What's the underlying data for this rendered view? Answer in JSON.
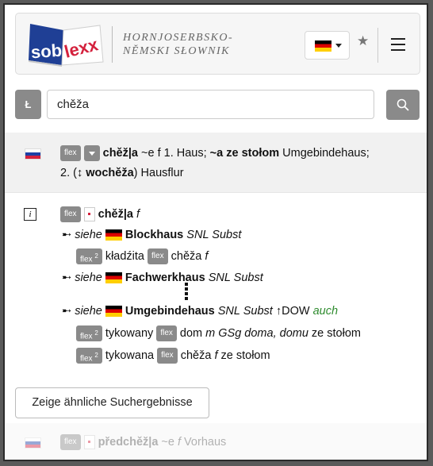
{
  "header": {
    "logo_left": "sob",
    "logo_right": "lexx",
    "title_line1": "HORNJOSERBSKO-",
    "title_line2": "NĚMSKI SŁOWNIK",
    "lang_flag": "flag-de",
    "star_icon": "star-icon",
    "menu_icon": "hamburger-icon"
  },
  "search": {
    "keyboard_label": "Ł",
    "value": "chěža",
    "button_icon": "search-icon"
  },
  "entry1": {
    "flex": "flex",
    "word": "chěž|a",
    "grammar": " ~e f 1. Haus; ",
    "phrase": "~a ze stołom",
    "phrase_tr": " Umgebindehaus;",
    "line2_prefix": "2. (↕ ",
    "line2_word": "wochěža",
    "line2_suffix": ") Hausflur"
  },
  "entry2": {
    "flex": "flex",
    "word": "chěž|a",
    "gender": "f",
    "refs": [
      {
        "siehe": "siehe",
        "word": "Blockhaus",
        "tag": "SNL Subst"
      },
      {
        "siehe": "siehe",
        "word": "Fachwerkhaus",
        "tag": "SNL Subst"
      },
      {
        "siehe": "siehe",
        "word": "Umgebindehaus",
        "tag": "SNL Subst",
        "dow": " ↑DOW ",
        "auch": "auch"
      }
    ],
    "sub1": {
      "flex2": "flex",
      "sup": "2",
      "w1": "kładźita",
      "flex": "flex",
      "w2": "chěža",
      "g": "f"
    },
    "sub2": {
      "flex2": "flex",
      "sup": "2",
      "w1": "tykowany",
      "flex": "flex",
      "w2": "dom",
      "g": "m GSg doma, domu",
      "rest": " ze stołom"
    },
    "sub3": {
      "flex2": "flex",
      "sup": "2",
      "w1": "tykowana",
      "flex": "flex",
      "w2": "chěža",
      "g": "f",
      "rest": " ze stołom"
    }
  },
  "similar_button": "Zeige ähnliche Suchergebnisse",
  "entry3": {
    "flex": "flex",
    "word": "předchěž|a",
    "grammar": " ~e ",
    "g": "f",
    "tr": " Vorhaus"
  }
}
